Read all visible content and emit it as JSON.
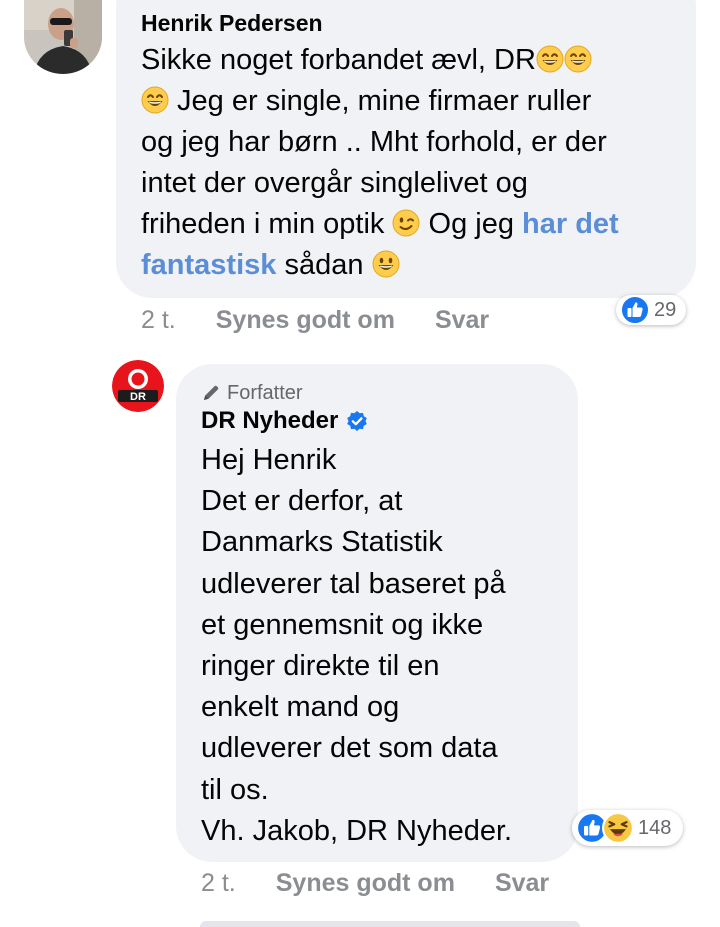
{
  "comments": [
    {
      "author": "Henrik Pedersen",
      "text_lines": [
        "Sikke noget forbandet ævl, DR",
        " Jeg er single, mine firmaer ruller",
        "og jeg har børn .. Mht forhold, er der",
        "intet der overgår singlelivet og",
        "friheden i min optik ",
        " Og jeg ",
        "har det",
        "fantastisk",
        " sådan "
      ],
      "time": "2 t.",
      "like_label": "Synes godt om",
      "reply_label": "Svar",
      "reaction_count": "29"
    },
    {
      "badge": "Forfatter",
      "author": "DR Nyheder",
      "text_lines": [
        "Hej Henrik",
        "Det er derfor, at",
        "Danmarks Statistik",
        "udleverer tal baseret på",
        "et gennemsnit og ikke",
        "ringer direkte til en",
        "enkelt mand og",
        "udleverer det som data",
        "til os.",
        "Vh. Jakob, DR Nyheder."
      ],
      "time": "2 t.",
      "like_label": "Synes godt om",
      "reply_label": "Svar",
      "reaction_count": "148"
    }
  ],
  "icons": {
    "like": "thumbs-up-icon",
    "haha": "laughing-face-icon",
    "verified": "verified-badge-icon",
    "badge": "pencil-icon"
  },
  "colors": {
    "bubble": "#f0f2f5",
    "link": "#5b8ed6",
    "like_blue": "#1877f2",
    "meta_grey": "#8a8d91",
    "dr_red": "#e8141b"
  }
}
